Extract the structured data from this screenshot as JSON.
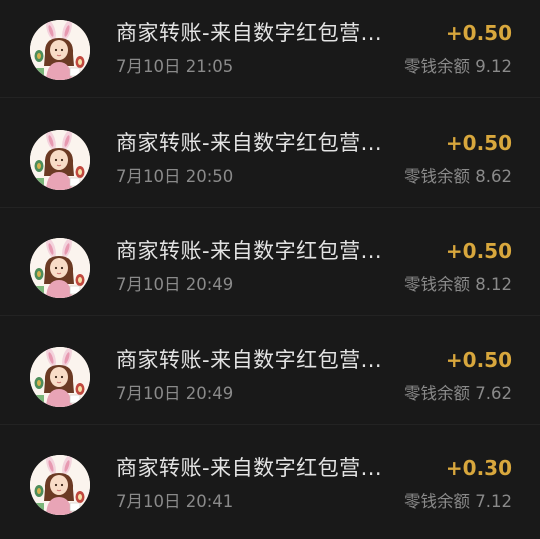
{
  "colors": {
    "background": "#191919",
    "title_text": "#e3e3e3",
    "secondary_text": "#8a8a8a",
    "amount_accent": "#d8a73d"
  },
  "transactions": [
    {
      "avatar_icon": "bunny-girl-avatar-icon",
      "title": "商家转账-来自数字红包营...",
      "time": "7月10日 21:05",
      "amount": "+0.50",
      "balance": "零钱余额 9.12"
    },
    {
      "avatar_icon": "bunny-girl-avatar-icon",
      "title": "商家转账-来自数字红包营...",
      "time": "7月10日 20:50",
      "amount": "+0.50",
      "balance": "零钱余额 8.62"
    },
    {
      "avatar_icon": "bunny-girl-avatar-icon",
      "title": "商家转账-来自数字红包营...",
      "time": "7月10日 20:49",
      "amount": "+0.50",
      "balance": "零钱余额 8.12"
    },
    {
      "avatar_icon": "bunny-girl-avatar-icon",
      "title": "商家转账-来自数字红包营...",
      "time": "7月10日 20:49",
      "amount": "+0.50",
      "balance": "零钱余额 7.62"
    },
    {
      "avatar_icon": "bunny-girl-avatar-icon",
      "title": "商家转账-来自数字红包营...",
      "time": "7月10日 20:41",
      "amount": "+0.30",
      "balance": "零钱余额 7.12"
    }
  ]
}
